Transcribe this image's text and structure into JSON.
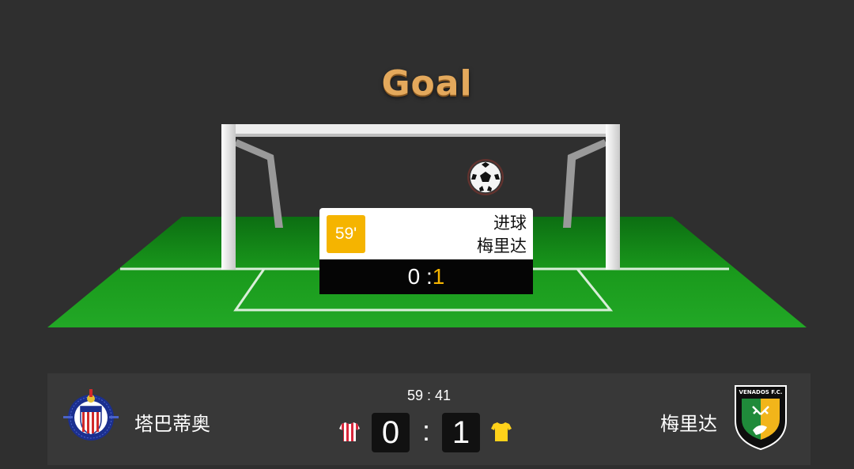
{
  "header": {
    "title": "Goal"
  },
  "event": {
    "minute": "59'",
    "type": "进球",
    "team": "梅里达",
    "score_home": "0",
    "score_separator": " :",
    "score_away": "1"
  },
  "scoreboard": {
    "clock": "59 : 41",
    "home": {
      "name": "塔巴蒂奥",
      "score": "0",
      "kit_icon": "red-white-striped-shirt-icon",
      "crest_icon": "chivas-crest-icon"
    },
    "away": {
      "name": "梅里达",
      "score": "1",
      "kit_icon": "yellow-shirt-icon",
      "crest_icon": "venados-crest-icon",
      "crest_text": "VENADOS F.C."
    },
    "separator": ":"
  },
  "colors": {
    "background": "#2f2f2f",
    "title": "#e4a95c",
    "badge": "#f5b400",
    "pitch": "#1f9a1f",
    "scorebar": "#383838"
  }
}
